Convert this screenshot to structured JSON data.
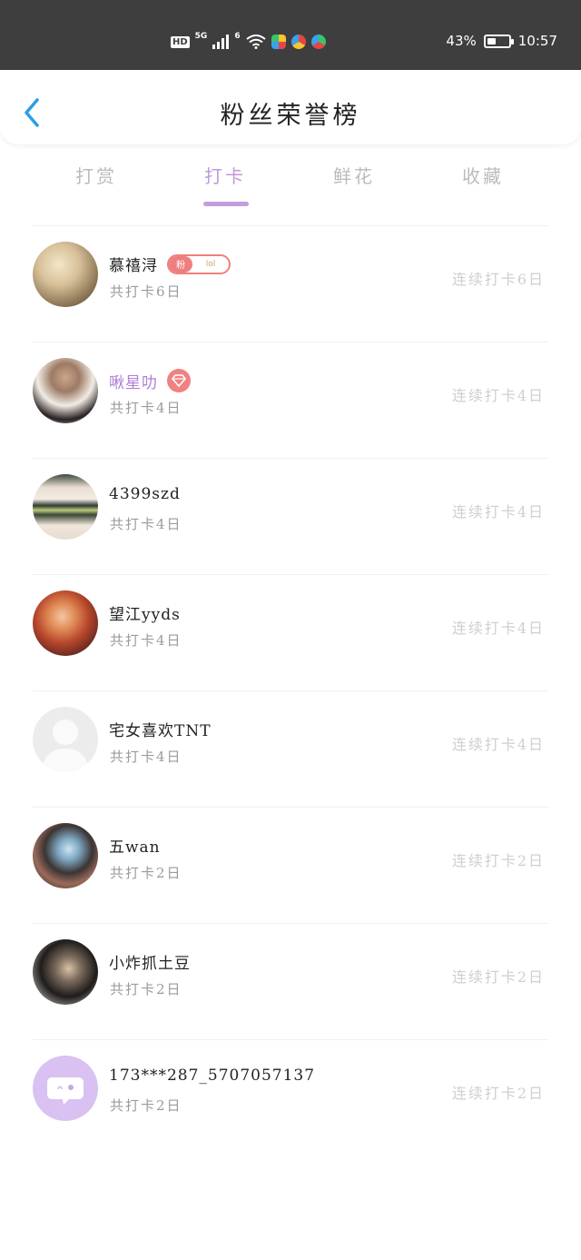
{
  "status_bar": {
    "hd": "HD",
    "net1": "5G",
    "net2": "6",
    "battery_percent": "43%",
    "battery_level": 0.43,
    "time": "10:57"
  },
  "navbar": {
    "title": "粉丝荣誉榜",
    "back_icon": "chevron-left-icon"
  },
  "tabs": [
    {
      "label": "打赏",
      "active": false
    },
    {
      "label": "打卡",
      "active": true
    },
    {
      "label": "鲜花",
      "active": false
    },
    {
      "label": "收藏",
      "active": false
    }
  ],
  "colors": {
    "accent": "#c39de0",
    "badge_red": "#f08080",
    "vip_name": "#b07ed8"
  },
  "fans": [
    {
      "name": "慕禧浔",
      "badge_type": "fan",
      "badge_left": "粉",
      "badge_right": "lol",
      "total": "共打卡6日",
      "streak": "连续打卡6日"
    },
    {
      "name": "啾星叻",
      "badge_type": "diamond",
      "total": "共打卡4日",
      "streak": "连续打卡4日"
    },
    {
      "name": "4399szd",
      "total": "共打卡4日",
      "streak": "连续打卡4日"
    },
    {
      "name": "望江yyds",
      "total": "共打卡4日",
      "streak": "连续打卡4日"
    },
    {
      "name": "宅女喜欢TNT",
      "total": "共打卡4日",
      "streak": "连续打卡4日"
    },
    {
      "name": "五wan",
      "total": "共打卡2日",
      "streak": "连续打卡2日"
    },
    {
      "name": "小炸抓土豆",
      "total": "共打卡2日",
      "streak": "连续打卡2日"
    },
    {
      "name": "173***287_5707057137",
      "total": "共打卡2日",
      "streak": "连续打卡2日"
    }
  ]
}
